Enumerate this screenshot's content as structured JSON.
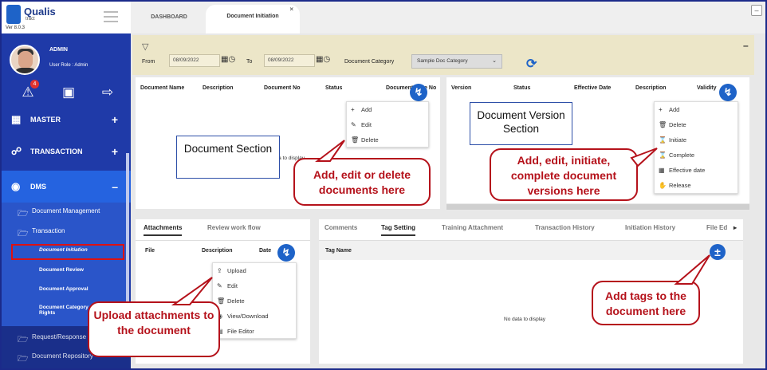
{
  "app": {
    "name": "Qualis",
    "sub": "tract",
    "version": "Ver 8.0.3"
  },
  "user": {
    "name": "ADMIN",
    "role": "User Role : Admin",
    "notifications": "4"
  },
  "sidebar": {
    "master": "MASTER",
    "transaction": "TRANSACTION",
    "dms": "DMS",
    "doc_management": "Document Management",
    "transaction_sub": "Transaction",
    "doc_initiation": "Document Initiation",
    "doc_review": "Document Review",
    "doc_approval": "Document Approval",
    "doc_category_rights": "Document Category Rights",
    "request_response": "Request/Response",
    "doc_repository": "Document Repository"
  },
  "tabs": {
    "dashboard": "DASHBOARD",
    "doc_initiation": "Document Initiation",
    "close": "×"
  },
  "filter": {
    "from_label": "From",
    "from_value": "08/09/2022",
    "to_label": "To",
    "to_value": "08/09/2022",
    "category_label": "Document Category",
    "category_value": "Sample Doc Category"
  },
  "doc_section": {
    "columns": [
      "Document Name",
      "Description",
      "Document No",
      "Status",
      "Document Type No"
    ],
    "menu": [
      "Add",
      "Edit",
      "Delete"
    ],
    "no_data": "No data to display",
    "label": "Document Section"
  },
  "version_section": {
    "columns": [
      "Version",
      "Status",
      "Effective Date",
      "Description",
      "Validity"
    ],
    "menu": [
      "Add",
      "Delete",
      "Initiate",
      "Complete",
      "Effective date",
      "Release"
    ],
    "label": "Document Version Section"
  },
  "attach_section": {
    "tabs": [
      "Attachments",
      "Review work flow"
    ],
    "columns": [
      "File",
      "Description",
      "Date"
    ],
    "menu": [
      "Upload",
      "Edit",
      "Delete",
      "View/Download",
      "File Editor"
    ]
  },
  "tag_section": {
    "tabs": [
      "Comments",
      "Tag Setting",
      "Training Attachment",
      "Transaction History",
      "Initiation History",
      "File Ed"
    ],
    "column": "Tag Name",
    "no_data": "No data to display"
  },
  "callouts": {
    "doc": "Add, edit or delete documents here",
    "version": "Add, edit, initiate, complete document versions here",
    "attach": "Upload attachments to the document",
    "tags": "Add tags to the document here"
  },
  "colors": {
    "primary": "#1e63c8",
    "sidebar": "#1f3aa8",
    "callout": "#b5121b",
    "filterbar": "#ece6c8"
  }
}
